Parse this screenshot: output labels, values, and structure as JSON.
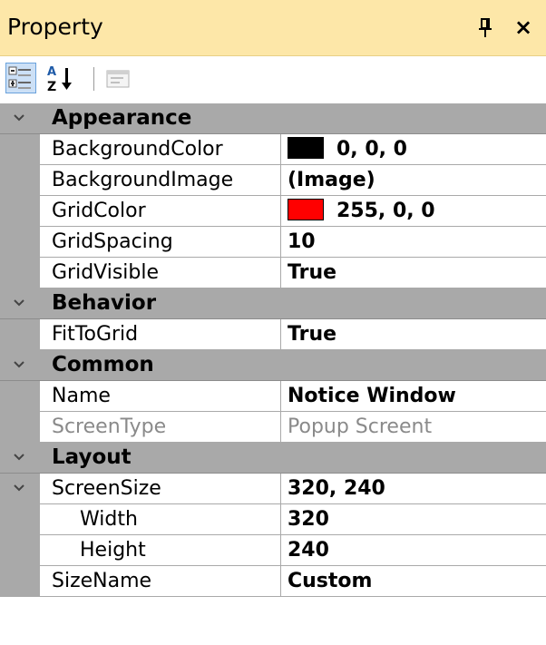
{
  "window": {
    "title": "Property",
    "pin_icon": "pin-icon",
    "close_glyph": "×"
  },
  "toolbar": {
    "categorized_icon": "categorized-icon",
    "alphabetical_icon": "sort-alpha-icon",
    "property_pages_icon": "property-pages-icon"
  },
  "colors": {
    "title_bg": "#fde7a8",
    "category_bg": "#a9a9a9",
    "swatch_black": "#000000",
    "swatch_red": "#ff0000"
  },
  "categories": [
    {
      "label": "Appearance",
      "properties": [
        {
          "name": "BackgroundColor",
          "value": "0, 0, 0",
          "swatch": "#000000"
        },
        {
          "name": "BackgroundImage",
          "value": "(Image)"
        },
        {
          "name": "GridColor",
          "value": "255, 0, 0",
          "swatch": "#ff0000"
        },
        {
          "name": "GridSpacing",
          "value": "10"
        },
        {
          "name": "GridVisible",
          "value": "True"
        }
      ]
    },
    {
      "label": "Behavior",
      "properties": [
        {
          "name": "FitToGrid",
          "value": "True"
        }
      ]
    },
    {
      "label": "Common",
      "properties": [
        {
          "name": "Name",
          "value": "Notice Window"
        },
        {
          "name": "ScreenType",
          "value": "Popup Screent",
          "disabled": true
        }
      ]
    },
    {
      "label": "Layout",
      "properties": [
        {
          "name": "ScreenSize",
          "value": "320, 240",
          "expandable": true
        },
        {
          "name": "Width",
          "value": "320",
          "child": true
        },
        {
          "name": "Height",
          "value": "240",
          "child": true
        },
        {
          "name": "SizeName",
          "value": "Custom"
        }
      ]
    }
  ]
}
